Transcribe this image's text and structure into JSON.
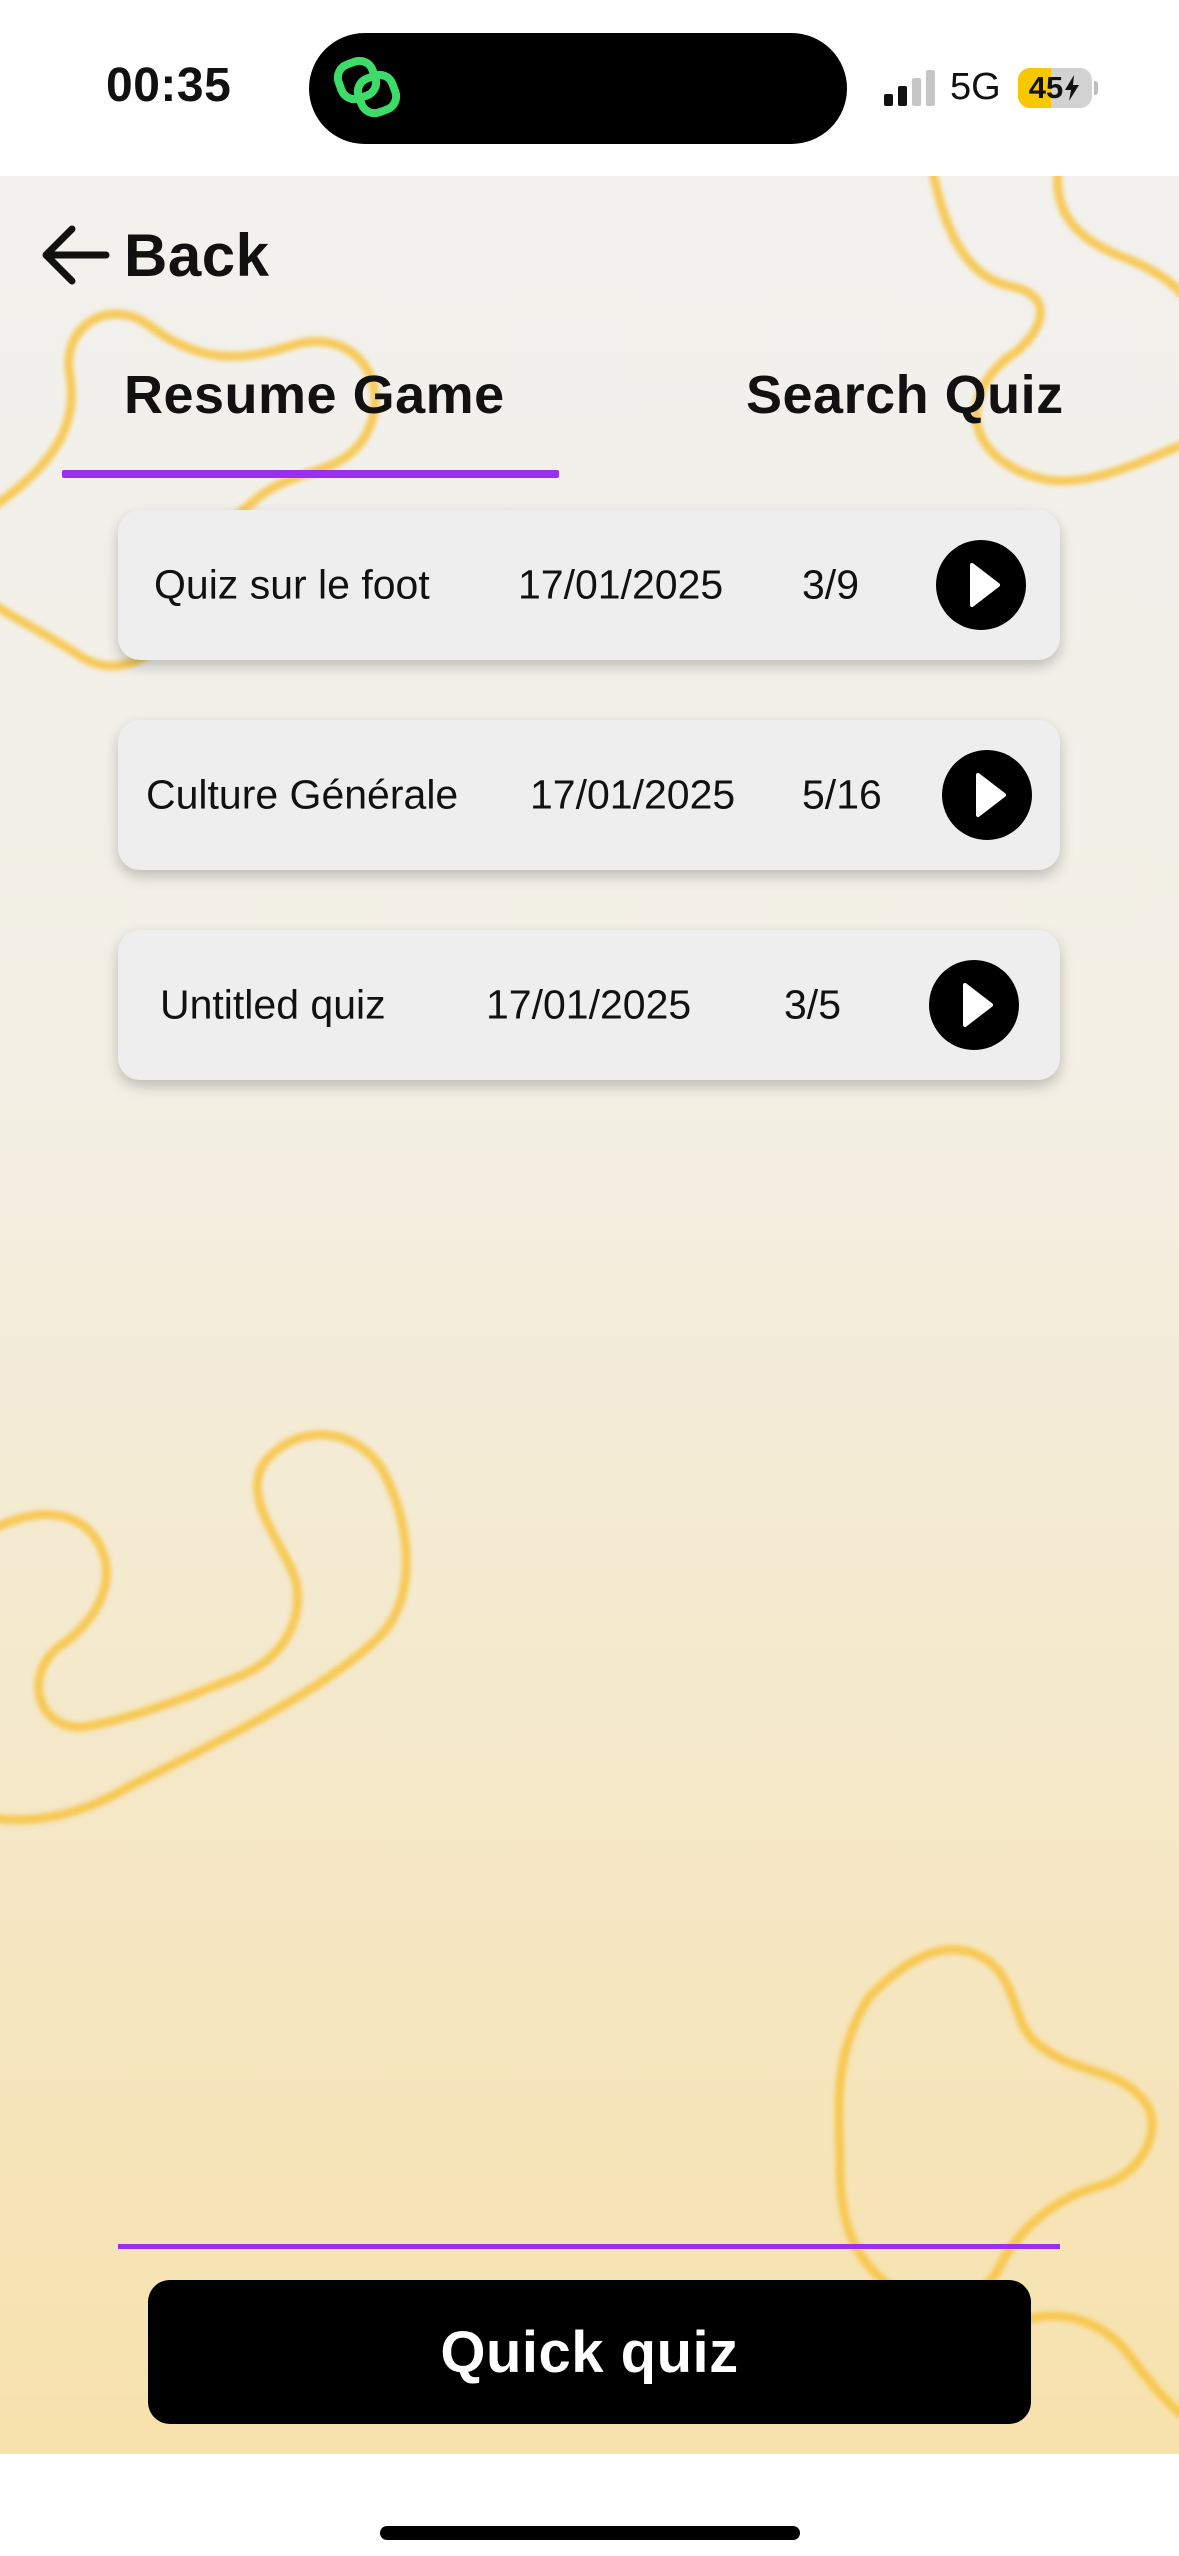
{
  "status_bar": {
    "time": "00:35",
    "island_icon": "linked-rings-icon",
    "signal_icon": "cellular-signal-icon",
    "network": "5G",
    "battery_level": "45",
    "battery_icon": "battery-charging-icon",
    "battery_fraction": 0.45
  },
  "nav": {
    "back_icon": "arrow-left-icon",
    "back_label": "Back"
  },
  "tabs": [
    {
      "label": "Resume Game",
      "active": true
    },
    {
      "label": "Search Quiz",
      "active": false
    }
  ],
  "games": [
    {
      "title": "Quiz sur le foot",
      "date": "17/01/2025",
      "progress": "3/9",
      "action_icon": "play-icon"
    },
    {
      "title": "Culture Générale",
      "date": "17/01/2025",
      "progress": "5/16",
      "action_icon": "play-icon"
    },
    {
      "title": "Untitled quiz",
      "date": "17/01/2025",
      "progress": "3/5",
      "action_icon": "play-icon"
    }
  ],
  "footer": {
    "quick_quiz_label": "Quick quiz"
  },
  "colors": {
    "accent": "#9b2ff0",
    "decoration": "#f8c340",
    "button": "#000000",
    "card": "#eeeeee",
    "island_icon": "#3ddc6a",
    "battery": "#f7c800"
  }
}
